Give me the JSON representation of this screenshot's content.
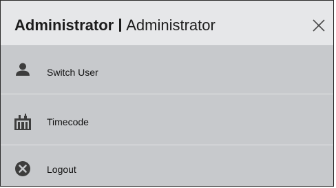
{
  "header": {
    "title_strong": "Administrator",
    "title_regular": "Administrator",
    "close_icon": "close-icon"
  },
  "menu": {
    "items": [
      {
        "icon": "user-icon",
        "label": "Switch User"
      },
      {
        "icon": "timecode-icon",
        "label": "Timecode"
      },
      {
        "icon": "logout-icon",
        "label": "Logout"
      }
    ]
  },
  "colors": {
    "header_bg": "#e6e7e9",
    "menu_bg": "#c7c9cc",
    "icon": "#3d3d3d",
    "text": "#111111"
  }
}
